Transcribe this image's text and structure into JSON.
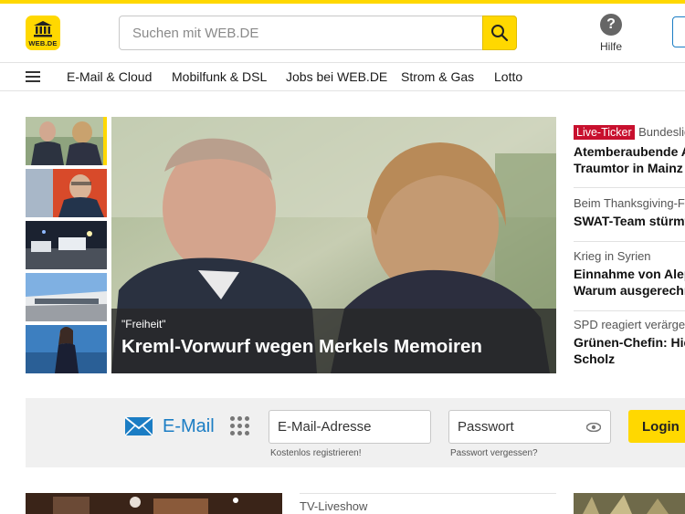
{
  "header": {
    "logo_text": "WEB.DE",
    "search_placeholder": "Suchen mit WEB.DE",
    "help_label": "Hilfe"
  },
  "nav": {
    "items": [
      "E-Mail & Cloud",
      "Mobilfunk & DSL",
      "Jobs bei WEB.DE",
      "Strom & Gas",
      "Lotto"
    ]
  },
  "hero": {
    "kicker": "\"Freiheit\"",
    "title": "Kreml-Vorwurf wegen Merkels Memoiren"
  },
  "side_news": [
    {
      "badge": "Live-Ticker",
      "kicker": "Bundesliga",
      "title_lines": [
        "Atemberaubende A",
        "Traumtor in Mainz"
      ]
    },
    {
      "kicker": "Beim Thanksgiving-Fe",
      "title_lines": [
        "SWAT-Team stürmt"
      ]
    },
    {
      "kicker": "Krieg in Syrien",
      "title_lines": [
        "Einnahme von Alep",
        "Warum ausgerechn"
      ]
    },
    {
      "kicker": "SPD reagiert verärger",
      "title_lines": [
        "Grünen-Chefin: Hie",
        "Scholz"
      ]
    }
  ],
  "mail": {
    "label": "E-Mail",
    "email_placeholder": "E-Mail-Adresse",
    "password_placeholder": "Passwort",
    "register_link": "Kostenlos registrieren!",
    "forgot_link": "Passwort vergessen?",
    "login_button": "Login"
  },
  "bottom": {
    "label": "TV-Liveshow"
  },
  "colors": {
    "brand_yellow": "#ffd800",
    "live_red": "#c8102e",
    "mail_blue": "#1b7dc4"
  },
  "icons": [
    "temple-logo-icon",
    "search-icon",
    "help-icon",
    "menu-icon",
    "envelope-icon",
    "apps-grid-icon",
    "eye-icon"
  ]
}
